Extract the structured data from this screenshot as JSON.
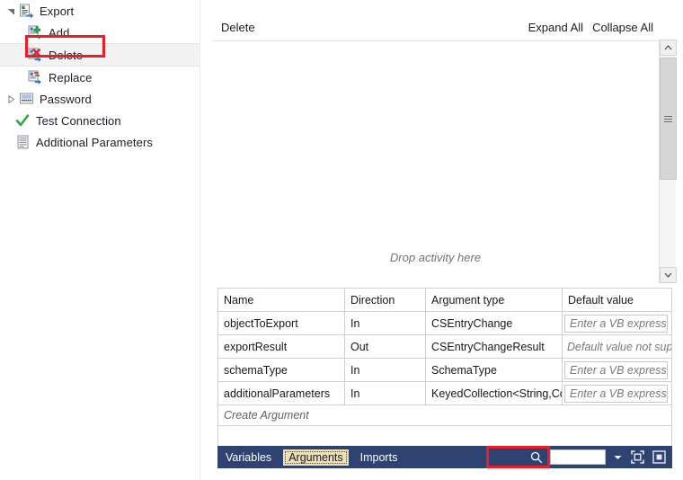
{
  "tree": {
    "items": [
      {
        "label": "Export",
        "icon": "export-icon",
        "indent": 0,
        "twisty": "expanded",
        "selected": false
      },
      {
        "label": "Add",
        "icon": "add-entry-icon",
        "indent": 1,
        "twisty": "none",
        "selected": false
      },
      {
        "label": "Delete",
        "icon": "delete-entry-icon",
        "indent": 1,
        "twisty": "none",
        "selected": true
      },
      {
        "label": "Replace",
        "icon": "replace-entry-icon",
        "indent": 1,
        "twisty": "none",
        "selected": false
      },
      {
        "label": "Password",
        "icon": "password-icon",
        "indent": 0,
        "twisty": "collapsed",
        "selected": false
      },
      {
        "label": "Test Connection",
        "icon": "test-connection-icon",
        "indent": -1,
        "twisty": "none",
        "selected": false
      },
      {
        "label": "Additional Parameters",
        "icon": "additional-parameters-icon",
        "indent": -1,
        "twisty": "none",
        "selected": false
      }
    ]
  },
  "designer": {
    "breadcrumb": "Delete",
    "expand_all_label": "Expand All",
    "collapse_all_label": "Collapse All",
    "drop_hint": "Drop activity here"
  },
  "arguments_grid": {
    "columns": [
      "Name",
      "Direction",
      "Argument type",
      "Default value"
    ],
    "rows": [
      {
        "name": "objectToExport",
        "direction": "In",
        "type": "CSEntryChange",
        "default_value": "",
        "default_placeholder": "Enter a VB expression",
        "default_editable": true
      },
      {
        "name": "exportResult",
        "direction": "Out",
        "type": "CSEntryChangeResult",
        "default_value": "Default value not suppo",
        "default_placeholder": "",
        "default_editable": false
      },
      {
        "name": "schemaType",
        "direction": "In",
        "type": "SchemaType",
        "default_value": "",
        "default_placeholder": "Enter a VB expression",
        "default_editable": true
      },
      {
        "name": "additionalParameters",
        "direction": "In",
        "type": "KeyedCollection<String,Con",
        "default_value": "",
        "default_placeholder": "Enter a VB expression",
        "default_editable": true
      }
    ],
    "create_argument_label": "Create Argument"
  },
  "bottom_bar": {
    "tabs": [
      {
        "label": "Variables",
        "active": false
      },
      {
        "label": "Arguments",
        "active": true
      },
      {
        "label": "Imports",
        "active": false
      }
    ],
    "search_value": "",
    "search_placeholder": "",
    "icons": {
      "search": "search-icon",
      "dropdown": "chevron-down-icon",
      "fit_to_screen": "fit-to-screen-icon",
      "restore_panel": "restore-panel-icon"
    }
  },
  "colors": {
    "bottom_bar": "#2e4372",
    "annotation": "#ee1c25",
    "active_tab": "#ede0b6",
    "selection": "#f2f2f2"
  }
}
